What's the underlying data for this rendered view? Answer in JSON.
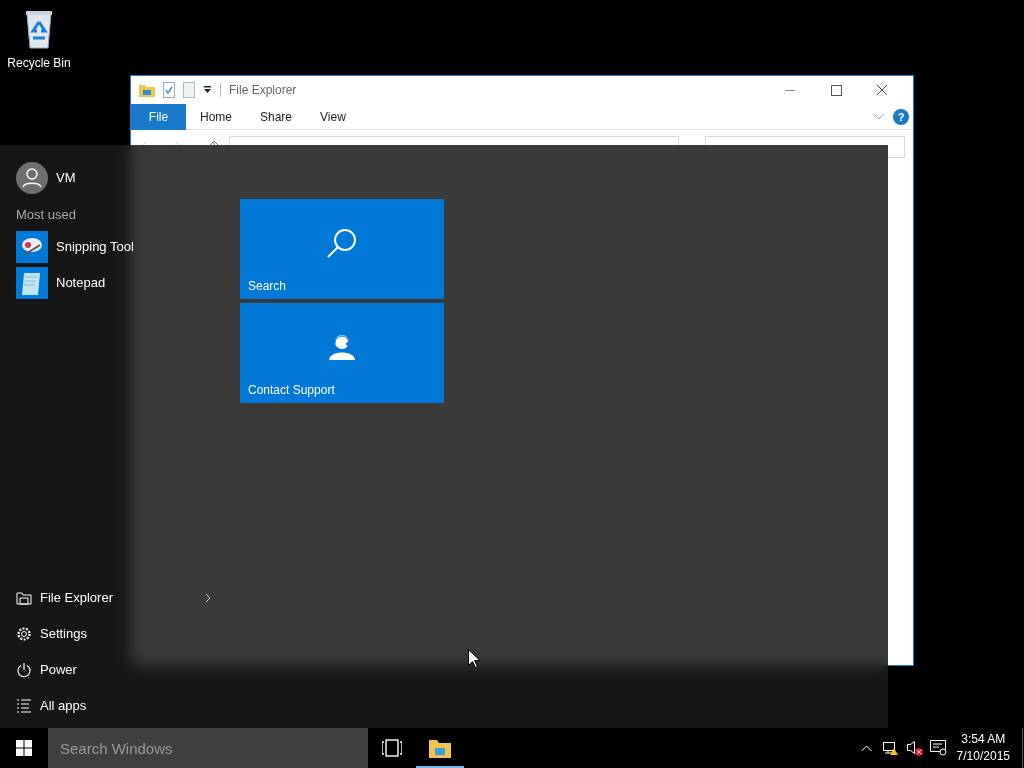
{
  "desktop": {
    "icons": [
      {
        "label": "Recycle Bin",
        "kind": "recycle-bin"
      }
    ]
  },
  "explorer": {
    "title": "File Explorer",
    "help_glyph": "?",
    "ribbon_tabs": [
      {
        "label": "File",
        "selected": true
      },
      {
        "label": "Home",
        "selected": false
      },
      {
        "label": "Share",
        "selected": false
      },
      {
        "label": "View",
        "selected": false
      }
    ]
  },
  "start_menu": {
    "user": "VM",
    "most_used_heading": "Most used",
    "most_used": [
      {
        "label": "Snipping Tool",
        "kind": "snipping"
      },
      {
        "label": "Notepad",
        "kind": "notepad"
      }
    ],
    "places": [
      {
        "label": "File Explorer",
        "kind": "folder",
        "has_submenu": true
      },
      {
        "label": "Settings",
        "kind": "settings",
        "has_submenu": false
      },
      {
        "label": "Power",
        "kind": "power",
        "has_submenu": false
      },
      {
        "label": "All apps",
        "kind": "list",
        "has_submenu": false
      }
    ],
    "tiles": [
      {
        "label": "Search",
        "kind": "search"
      },
      {
        "label": "Contact Support",
        "kind": "support"
      }
    ]
  },
  "taskbar": {
    "search_placeholder": "Search Windows",
    "apps": [
      {
        "kind": "task-view",
        "running": false
      },
      {
        "kind": "explorer",
        "running": true
      }
    ],
    "clock": {
      "time": "3:54 AM",
      "date": "7/10/2015"
    }
  }
}
